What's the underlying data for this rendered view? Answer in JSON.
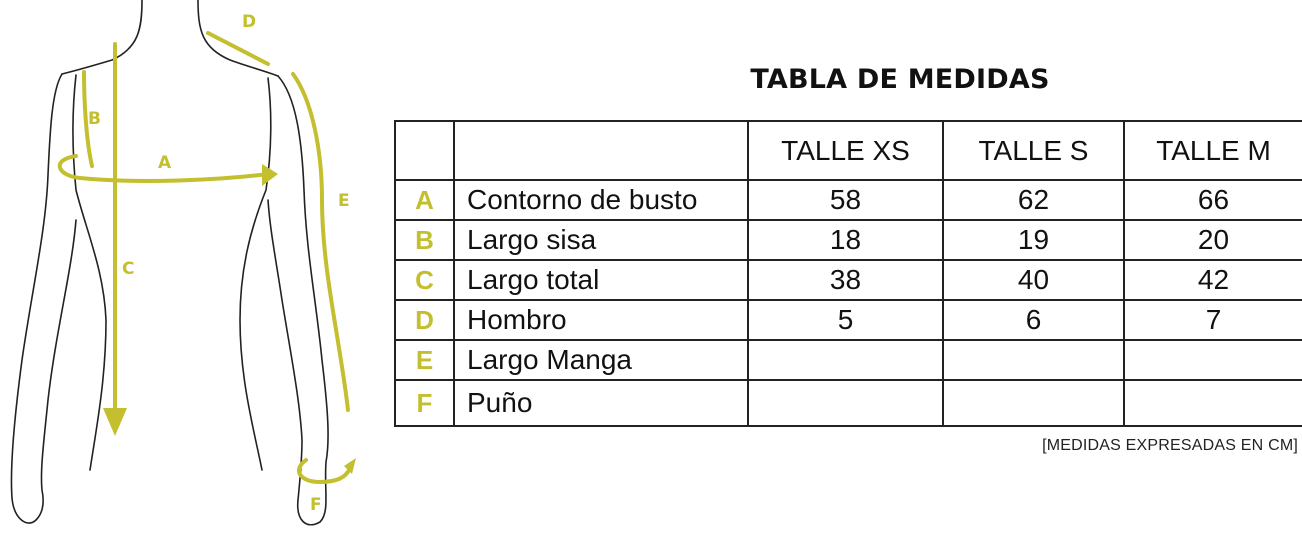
{
  "title": "TABLA DE MEDIDAS",
  "columns": [
    "",
    "",
    "TALLE XS",
    "TALLE S",
    "TALLE M"
  ],
  "rows": [
    {
      "code": "A",
      "name": "Contorno de busto",
      "xs": "58",
      "s": "62",
      "m": "66"
    },
    {
      "code": "B",
      "name": "Largo sisa",
      "xs": "18",
      "s": "19",
      "m": "20"
    },
    {
      "code": "C",
      "name": "Largo total",
      "xs": "38",
      "s": "40",
      "m": "42"
    },
    {
      "code": "D",
      "name": "Hombro",
      "xs": "5",
      "s": "6",
      "m": "7"
    },
    {
      "code": "E",
      "name": "Largo Manga",
      "xs": "",
      "s": "",
      "m": ""
    },
    {
      "code": "F",
      "name": "Puño",
      "xs": "",
      "s": "",
      "m": ""
    }
  ],
  "note": "[MEDIDAS EXPRESADAS EN CM]",
  "figure_labels": {
    "a": "A",
    "b": "B",
    "c": "C",
    "d": "D",
    "e": "E",
    "f": "F"
  },
  "colors": {
    "accent": "#c3bf2e",
    "line": "#222222"
  }
}
